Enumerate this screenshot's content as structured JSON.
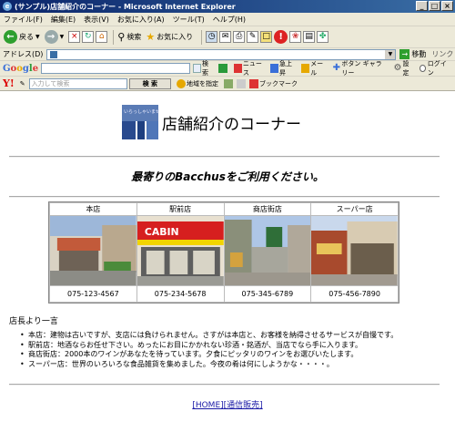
{
  "window": {
    "title": "(サンプル)店舗紹介のコーナー - Microsoft Internet Explorer",
    "controls": [
      "_",
      "□",
      "×"
    ]
  },
  "menu": [
    "ファイル(F)",
    "編集(E)",
    "表示(V)",
    "お気に入り(A)",
    "ツール(T)",
    "ヘルプ(H)"
  ],
  "toolbar": {
    "back": "戻る",
    "search": "検索",
    "favorites": "お気に入り"
  },
  "addressbar": {
    "label": "アドレス(D)",
    "value": "",
    "go": "移動",
    "links": "リンク"
  },
  "google_toolbar": {
    "logo": "Google",
    "search_button": "検索",
    "items": [
      "PageRank",
      "ニュース",
      "急上昇",
      "メール",
      "ボタン ギャラリー"
    ],
    "settings": "設定",
    "radio_label": "ログイン"
  },
  "yahoo_toolbar": {
    "logo": "Y!",
    "search_placeholder": "入力して検索",
    "search_button": "検 索",
    "highlight": "地域を指定",
    "bookmarks": "ブックマーク"
  },
  "page": {
    "logo_text": "いらっしゃいませ",
    "title": "店舗紹介のコーナー",
    "tagline": "最寄りのBacchusをご利用ください。",
    "stores": [
      {
        "name": "本店",
        "phone": "075-123-4567",
        "palette": [
          "#9db7d9",
          "#c25a3a",
          "#4b8b3b",
          "#d9d2c3"
        ]
      },
      {
        "name": "駅前店",
        "phone": "075-234-5678",
        "palette": [
          "#e8e0d0",
          "#d61f1f",
          "#f2d400",
          "#5e5e5e"
        ],
        "sign": "CABIN"
      },
      {
        "name": "商店街店",
        "phone": "075-345-6789",
        "palette": [
          "#aec6e6",
          "#8a8f7a",
          "#2f6e38",
          "#b0a89a"
        ]
      },
      {
        "name": "スーパー店",
        "phone": "075-456-7890",
        "palette": [
          "#c9d8ec",
          "#a84a2d",
          "#6b5e4c",
          "#d8cbb2"
        ]
      }
    ],
    "manager_heading": "店長より一言",
    "notes": [
      "本店：建物は古いですが、支店には負けられません。さすがは本店と、お客様を納得させるサービスが自慢です。",
      "駅前店：地酒ならお任せ下さい。めったにお目にかかれない珍酒・銘酒が、当店でなら手に入ります。",
      "商店街店：2000本のワインがあなたを待っています。夕食にピッタリのワインをお選びいたします。",
      "スーパー店：世界のいろいろな食品雑貨を集めました。今夜の肴は何にしようかな・・・・。"
    ],
    "footer_links": [
      "[HOME]",
      "[通信販売]"
    ]
  }
}
